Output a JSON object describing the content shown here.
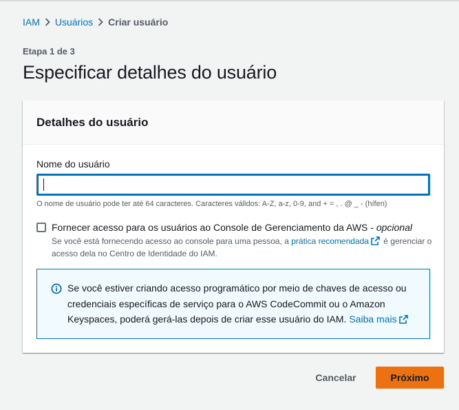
{
  "breadcrumb": {
    "items": [
      {
        "label": "IAM"
      },
      {
        "label": "Usuários"
      },
      {
        "label": "Criar usuário"
      }
    ]
  },
  "step_label": "Etapa 1 de 3",
  "page_title": "Especificar detalhes do usuário",
  "panel": {
    "title": "Detalhes do usuário",
    "username_field": {
      "label": "Nome do usuário",
      "value": "",
      "placeholder": "",
      "constraint": "O nome de usuário pode ter até 64 caracteres. Caracteres válidos: A-Z, a-z, 0-9, and + = , . @ _ - (hífen)"
    },
    "console_access": {
      "checked": false,
      "label": "Fornecer acesso para os usuários ao Console de Gerenciamento da AWS",
      "optional_suffix": " - opcional",
      "desc_before": "Se você está fornecendo acesso ao console para uma pessoa, a ",
      "desc_link": "prática recomendada",
      "desc_after": " é gerenciar o acesso dela no Centro de Identidade do IAM."
    },
    "info": {
      "text": "Se você estiver criando acesso programático por meio de chaves de acesso ou credenciais específicas de serviço para o AWS CodeCommit ou o Amazon Keyspaces, poderá gerá-las depois de criar esse usuário do IAM. ",
      "link": "Saiba mais"
    }
  },
  "actions": {
    "cancel_label": "Cancelar",
    "next_label": "Próximo"
  },
  "colors": {
    "link": "#0073bb",
    "primary_button": "#ec7211",
    "info_background": "#f1faff",
    "page_background": "#f2f3f3"
  },
  "icons": [
    "chevron-right-icon",
    "external-link-icon",
    "info-icon"
  ]
}
